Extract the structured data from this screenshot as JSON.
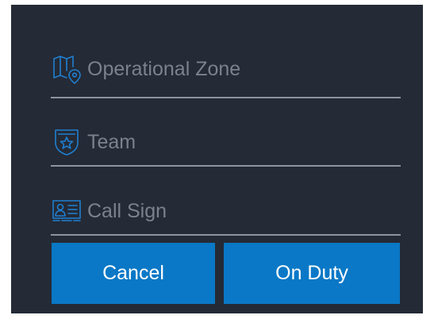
{
  "form": {
    "fields": [
      {
        "label": "Operational Zone",
        "icon": "map-pin-icon"
      },
      {
        "label": "Team",
        "icon": "star-shield-icon"
      },
      {
        "label": "Call Sign",
        "icon": "id-card-icon"
      }
    ]
  },
  "actions": {
    "cancel_label": "Cancel",
    "on_duty_label": "On Duty"
  },
  "colors": {
    "background": "#242a36",
    "accent": "#0a78c6",
    "icon": "#1f7fd0",
    "placeholder_text": "#7c828c",
    "divider": "#8e949e"
  }
}
